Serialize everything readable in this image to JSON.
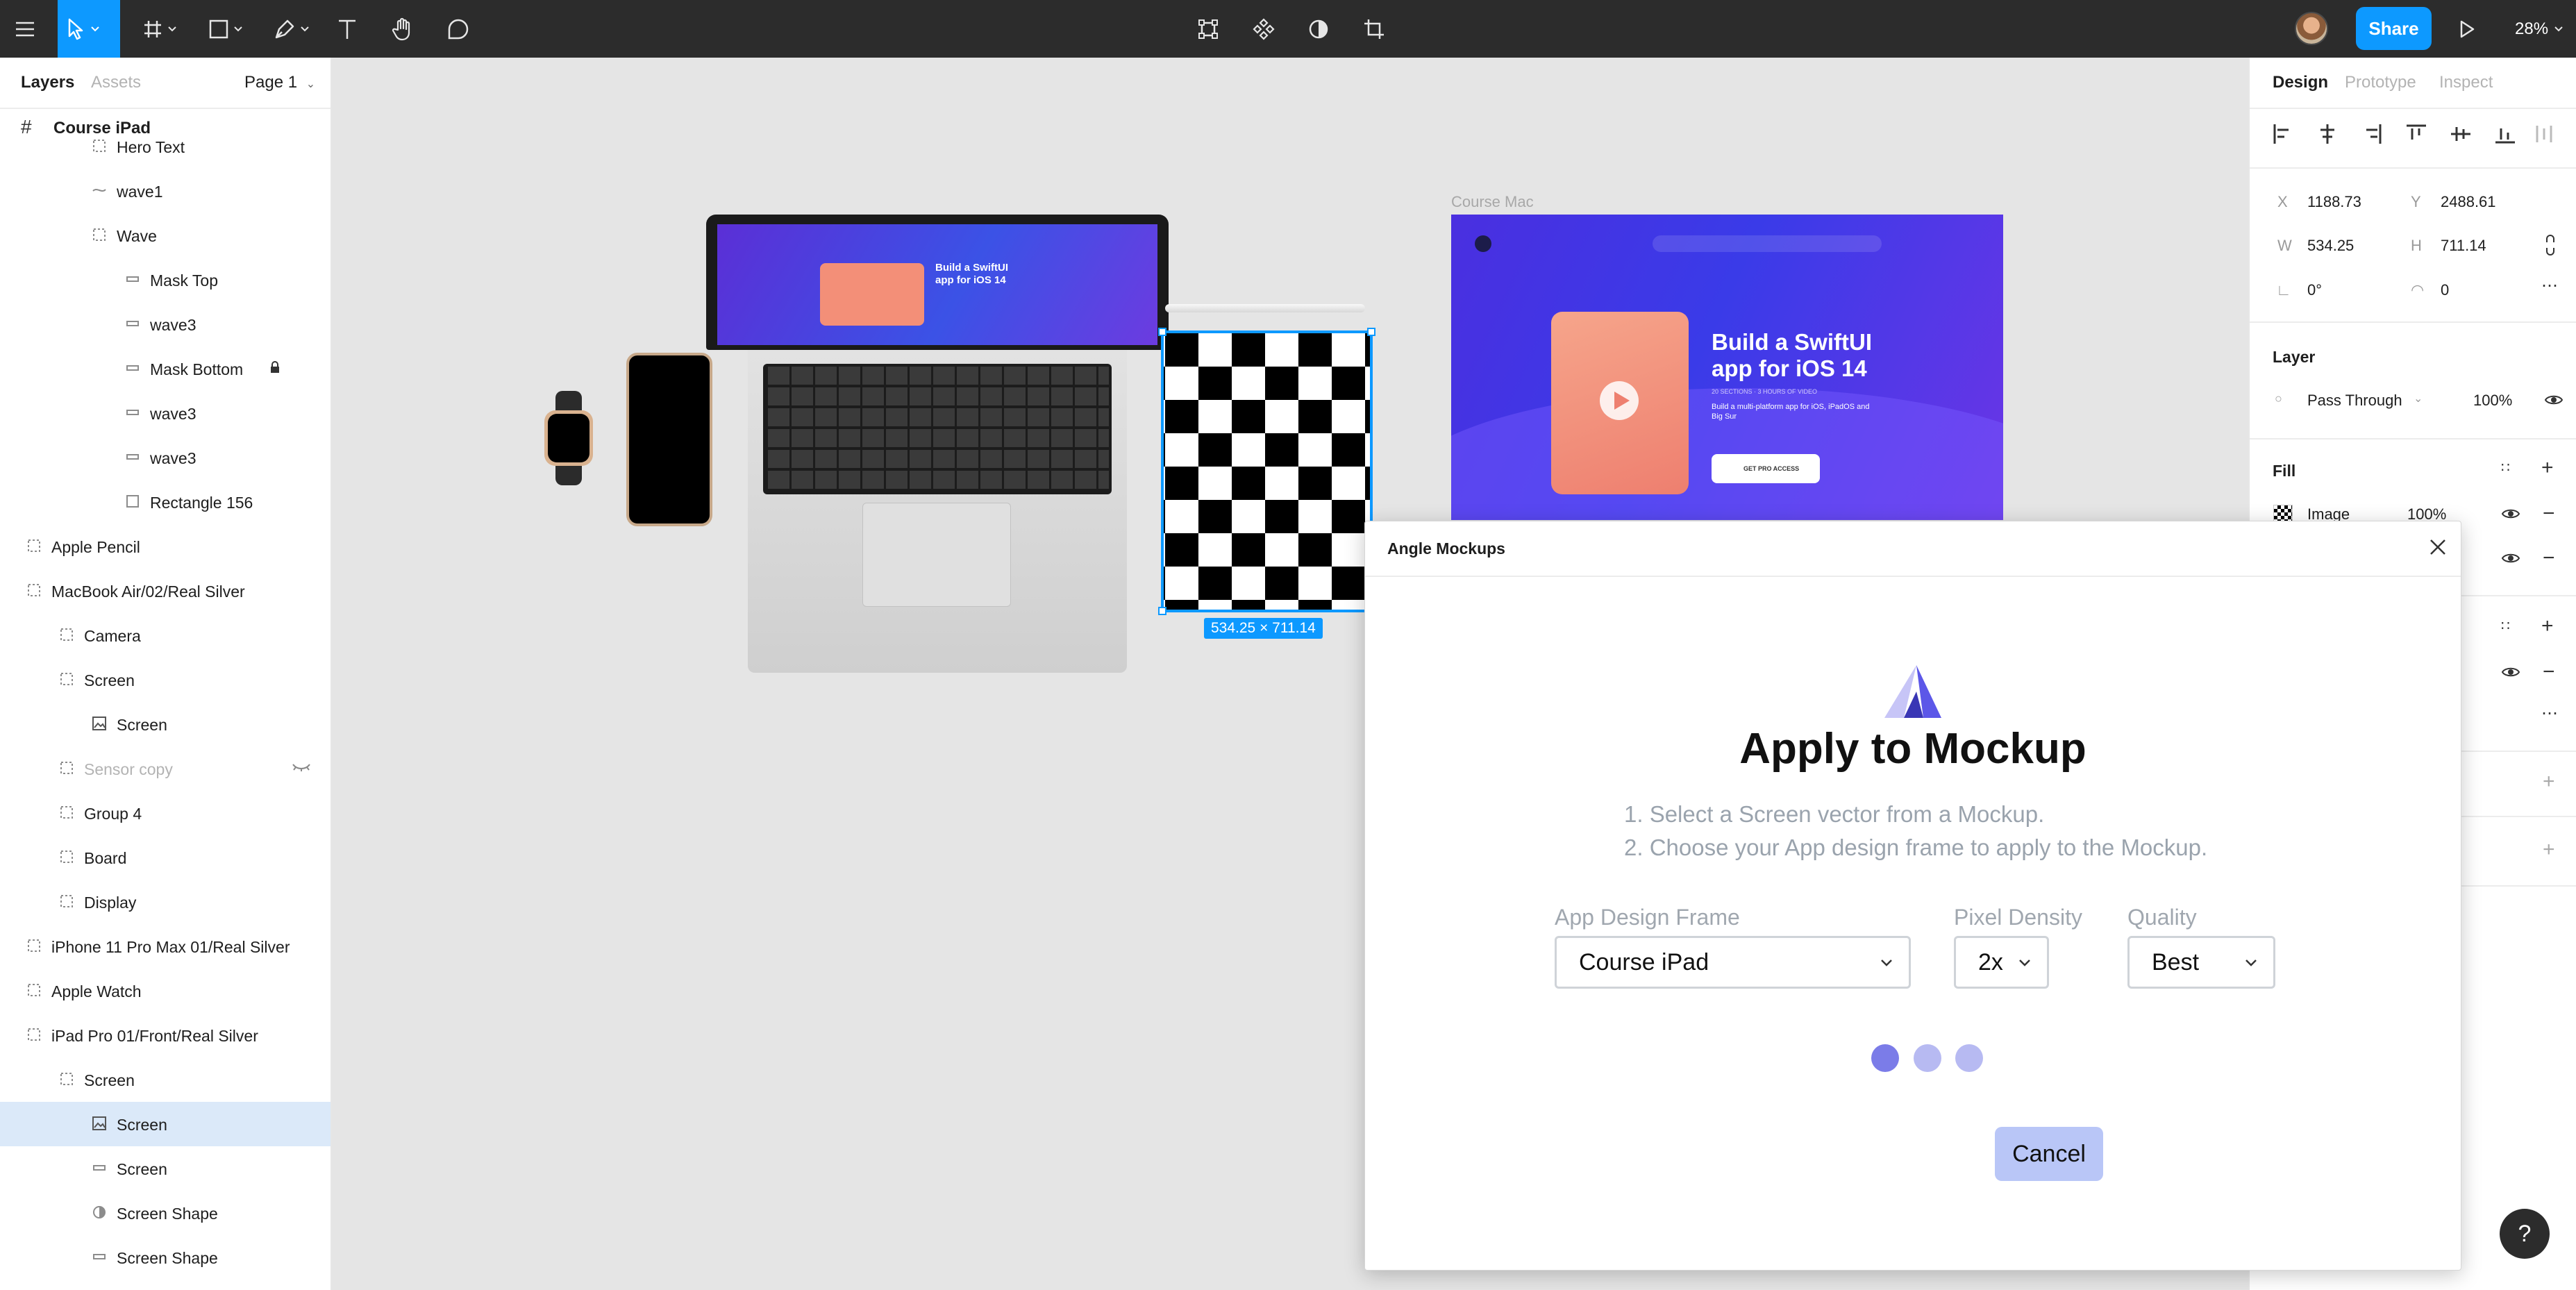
{
  "toolbar": {
    "share_label": "Share",
    "zoom_label": "28%"
  },
  "left_panel": {
    "tabs": {
      "layers": "Layers",
      "assets": "Assets"
    },
    "page_selector": "Page 1",
    "frame_name": "Course iPad",
    "layers": [
      {
        "label": "Hero Text",
        "indent": 2,
        "icon": "text-layer-icon"
      },
      {
        "label": "wave1",
        "indent": 2,
        "icon": "vector-icon"
      },
      {
        "label": "Wave",
        "indent": 2,
        "icon": "group-icon"
      },
      {
        "label": "Mask Top",
        "indent": 3,
        "icon": "rectangle-icon"
      },
      {
        "label": "wave3",
        "indent": 3,
        "icon": "rectangle-icon"
      },
      {
        "label": "Mask Bottom",
        "indent": 3,
        "icon": "rectangle-icon",
        "locked": true
      },
      {
        "label": "wave3",
        "indent": 3,
        "icon": "rectangle-icon"
      },
      {
        "label": "wave3",
        "indent": 3,
        "icon": "rectangle-icon"
      },
      {
        "label": "Rectangle 156",
        "indent": 3,
        "icon": "square-icon"
      },
      {
        "label": "Apple Pencil",
        "indent": 0,
        "icon": "group-icon"
      },
      {
        "label": "MacBook Air/02/Real Silver",
        "indent": 0,
        "icon": "group-icon"
      },
      {
        "label": "Camera",
        "indent": 1,
        "icon": "group-icon"
      },
      {
        "label": "Screen",
        "indent": 1,
        "icon": "group-icon"
      },
      {
        "label": "Screen",
        "indent": 2,
        "icon": "image-icon"
      },
      {
        "label": "Sensor copy",
        "indent": 1,
        "icon": "group-icon",
        "hidden": true
      },
      {
        "label": "Group 4",
        "indent": 1,
        "icon": "group-icon"
      },
      {
        "label": "Board",
        "indent": 1,
        "icon": "group-icon"
      },
      {
        "label": "Display",
        "indent": 1,
        "icon": "group-icon"
      },
      {
        "label": "iPhone 11 Pro Max 01/Real Silver",
        "indent": 0,
        "icon": "group-icon"
      },
      {
        "label": "Apple Watch",
        "indent": 0,
        "icon": "group-icon"
      },
      {
        "label": "iPad Pro 01/Front/Real Silver",
        "indent": 0,
        "icon": "group-icon"
      },
      {
        "label": "Screen",
        "indent": 1,
        "icon": "group-icon"
      },
      {
        "label": "Screen",
        "indent": 2,
        "icon": "image-icon",
        "selected": true
      },
      {
        "label": "Screen",
        "indent": 2,
        "icon": "rectangle-icon"
      },
      {
        "label": "Screen Shape",
        "indent": 2,
        "icon": "boolean-icon"
      },
      {
        "label": "Screen Shape",
        "indent": 2,
        "icon": "rectangle-icon"
      }
    ]
  },
  "canvas": {
    "frame_label": "Course Mac",
    "selection_size": "534.25 × 711.14",
    "mac_headline": "Build a SwiftUI app for iOS 14",
    "mac_subtext": "Build a multi-platform app for iOS, iPadOS and Big Sur",
    "mac_meta": "20 SECTIONS · 3 HOURS OF VIDEO",
    "mac_cta": "GET PRO ACCESS"
  },
  "right_panel": {
    "tabs": {
      "design": "Design",
      "prototype": "Prototype",
      "inspect": "Inspect"
    },
    "x_label": "X",
    "x_value": "1188.73",
    "y_label": "Y",
    "y_value": "2488.61",
    "w_label": "W",
    "w_value": "534.25",
    "h_label": "H",
    "h_value": "711.14",
    "rotation_value": "0°",
    "radius_value": "0",
    "layer_title": "Layer",
    "blend_mode": "Pass Through",
    "opacity": "100%",
    "fill_title": "Fill",
    "fill_type": "Image",
    "fill_opacity": "100%"
  },
  "dialog": {
    "title": "Angle Mockups",
    "heading": "Apply to Mockup",
    "step1": "1. Select a Screen vector from a Mockup.",
    "step2": "2. Choose your App design frame to apply to the Mockup.",
    "frame_label": "App Design Frame",
    "frame_value": "Course iPad",
    "density_label": "Pixel Density",
    "density_value": "2x",
    "quality_label": "Quality",
    "quality_value": "Best",
    "cancel_label": "Cancel"
  },
  "help_label": "?",
  "colors": {
    "accent": "#0d99ff",
    "toolbar_bg": "#2c2c2c",
    "selection_bg": "#dbe9f9",
    "dot_active": "#7b7ce8",
    "dot_inactive": "#b7baf2",
    "cancel_bg": "#b9c6f7"
  }
}
